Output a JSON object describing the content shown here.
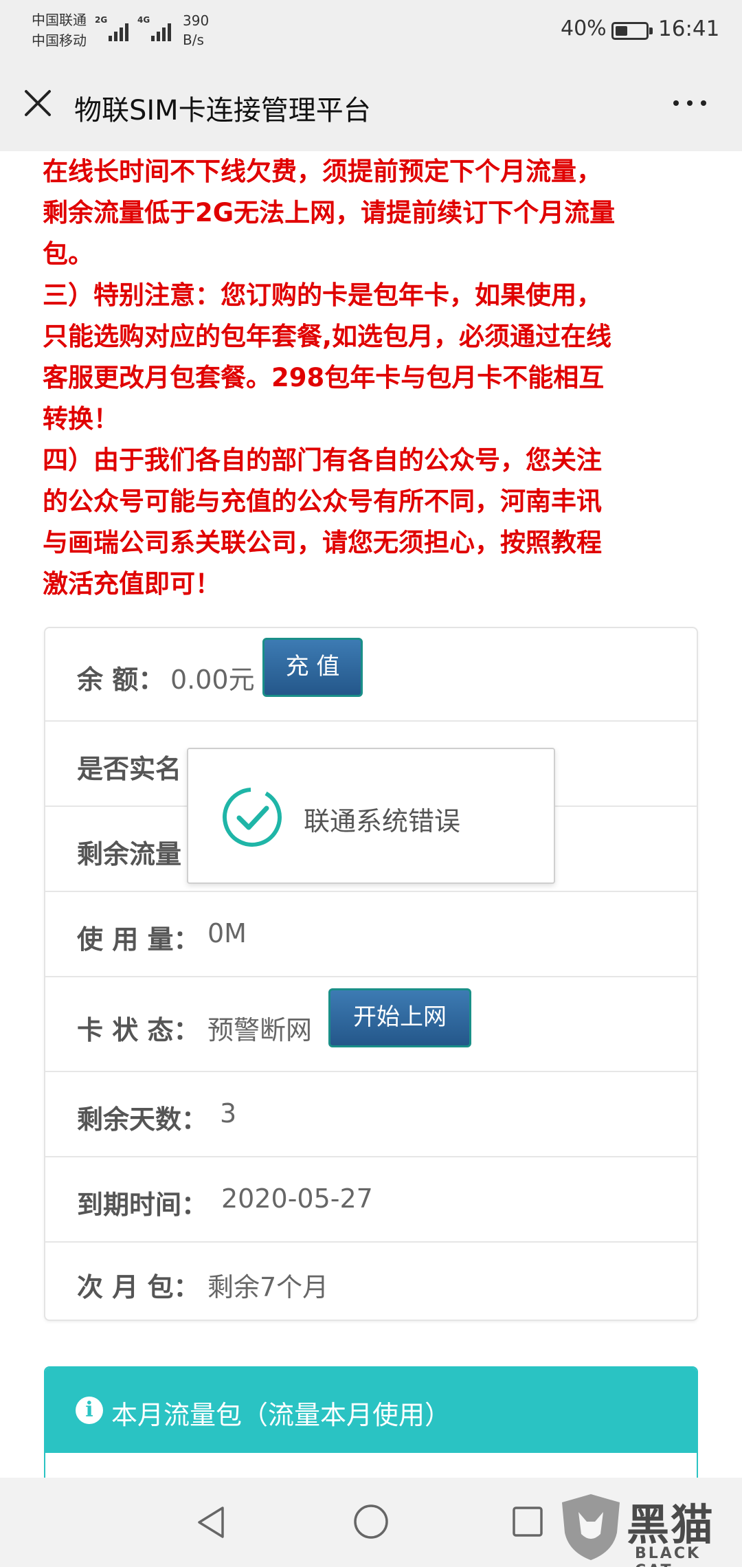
{
  "status_bar": {
    "carrier_1": "中国联通",
    "carrier_2": "中国移动",
    "signal_1": "2G",
    "signal_2": "4G",
    "speed_value": "390",
    "speed_unit": "B/s",
    "battery_percent": "40%",
    "battery_level": 0.4,
    "time": "16:41"
  },
  "nav": {
    "title": "物联SIM卡连接管理平台",
    "close_icon": "close-icon",
    "more_icon": "more-icon"
  },
  "notice_lines": [
    "在线长时间不下线欠费，须提前预定下个月流量，",
    "剩余流量低于2G无法上网，请提前续订下个月流量",
    "包。",
    "三）特别注意：您订购的卡是包年卡，如果使用，",
    "只能选购对应的包年套餐,如选包月，必须通过在线",
    "客服更改月包套餐。298包年卡与包月卡不能相互",
    "转换！",
    "四）由于我们各自的部门有各自的公众号，您关注",
    "的公众号可能与充值的公众号有所不同，河南丰讯",
    "与画瑞公司系关联公司，请您无须担心，按照教程",
    "激活充值即可！"
  ],
  "info": {
    "balance": {
      "label": "余 额：",
      "value": "0.00元",
      "button": "充 值"
    },
    "realname": {
      "label": "是否实名"
    },
    "remaining_flow": {
      "label": "剩余流量"
    },
    "usage": {
      "label": "使 用 量：",
      "value": "0M"
    },
    "card_status": {
      "label": "卡 状 态：",
      "value": "预警断网",
      "button": "开始上网"
    },
    "days_left": {
      "label": "剩余天数：",
      "value": "3"
    },
    "expiry": {
      "label": "到期时间：",
      "value": "2020-05-27"
    },
    "next_package": {
      "label": "次 月 包：",
      "value": "剩余7个月"
    }
  },
  "toast": {
    "message": "联通系统错误",
    "icon": "check-circle-icon"
  },
  "package_section": {
    "icon": "info-icon",
    "icon_glyph": "i",
    "title": "本月流量包（流量本月使用）"
  },
  "system_nav": {
    "back_icon": "back-triangle-icon",
    "home_icon": "home-circle-icon",
    "recent_icon": "recent-square-icon"
  },
  "watermark": {
    "name": "黑猫",
    "sub": "BLACK CAT"
  },
  "colors": {
    "notice_red": "#e00000",
    "button_blue": "#2f68a0",
    "teal": "#2ac3c3",
    "toast_check": "#1fb5a7"
  }
}
